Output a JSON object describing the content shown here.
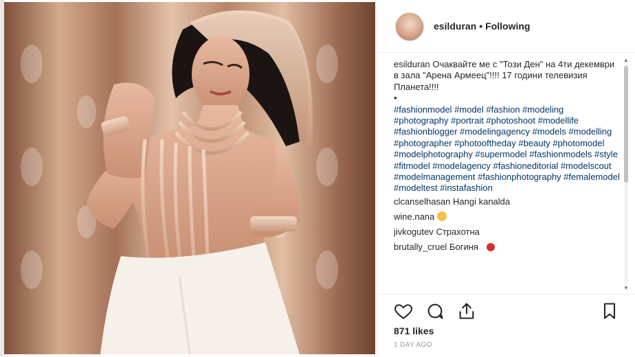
{
  "post": {
    "username": "esilduran",
    "separator": "•",
    "follow_status": "Following",
    "caption": {
      "username": "esilduran",
      "text": "Очаквайте ме с \"Този Ден\" на 4ти декември в зала \"Арена Армеец\"!!!! 17 години телевизия Планета!!!!",
      "bullet": "•",
      "hashtags": "#fashionmodel #model #fashion #modeling #photography #portrait #photoshoot #modellife #fashionblogger #modelingagency #models #modelling #photographer #photooftheday #beauty #photomodel #modelphotography #supermodel #fashionmodels #style #fitmodel #modelagency #fashioneditorial #modelscout #modelmanagement #fashionphotography #femalemodel #modeltest #instafashion"
    },
    "comments": [
      {
        "user": "clcanselhasan",
        "text": "Hangi kanalda"
      },
      {
        "user": "wine.nana",
        "text": "",
        "emoji": "laughing-emoji"
      },
      {
        "user": "jivkogutev",
        "text": "Страхотна"
      },
      {
        "user": "brutally_cruel",
        "text": "Богиня",
        "emoji": "red-heart-emoji"
      }
    ],
    "likes": "871 likes",
    "time": "1 DAY AGO"
  },
  "icons": {
    "like": "heart-icon",
    "comment": "comment-icon",
    "share": "share-icon",
    "save": "bookmark-icon"
  }
}
